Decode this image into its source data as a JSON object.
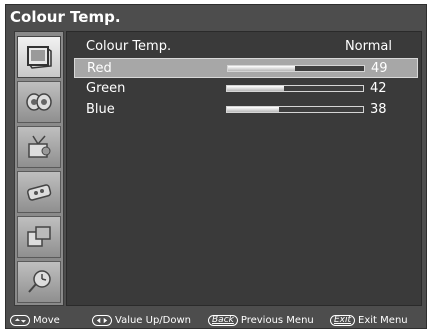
{
  "window": {
    "title": "Colour Temp."
  },
  "sidebar": {
    "items": [
      {
        "icon": "picture-icon",
        "active": true
      },
      {
        "icon": "sound-icon",
        "active": false
      },
      {
        "icon": "channel-icon",
        "active": false
      },
      {
        "icon": "features-icon",
        "active": false
      },
      {
        "icon": "input-icon",
        "active": false
      },
      {
        "icon": "timer-icon",
        "active": false
      }
    ]
  },
  "menu": {
    "colour_temp": {
      "label": "Colour Temp.",
      "value": "Normal"
    },
    "rows": [
      {
        "label": "Red",
        "value": "49",
        "level": 0.49,
        "selected": true
      },
      {
        "label": "Green",
        "value": "42",
        "level": 0.42,
        "selected": false
      },
      {
        "label": "Blue",
        "value": "38",
        "level": 0.38,
        "selected": false
      }
    ]
  },
  "status_bar": {
    "move": "Move",
    "value_updown": "Value Up/Down",
    "back_key": "Back",
    "previous_menu": "Previous Menu",
    "exit_key": "Exit",
    "exit_menu": "Exit Menu"
  },
  "colors": {
    "panel": "#3a3a3a",
    "frame": "#4d4d4d",
    "highlight": "#a7a7a7"
  }
}
